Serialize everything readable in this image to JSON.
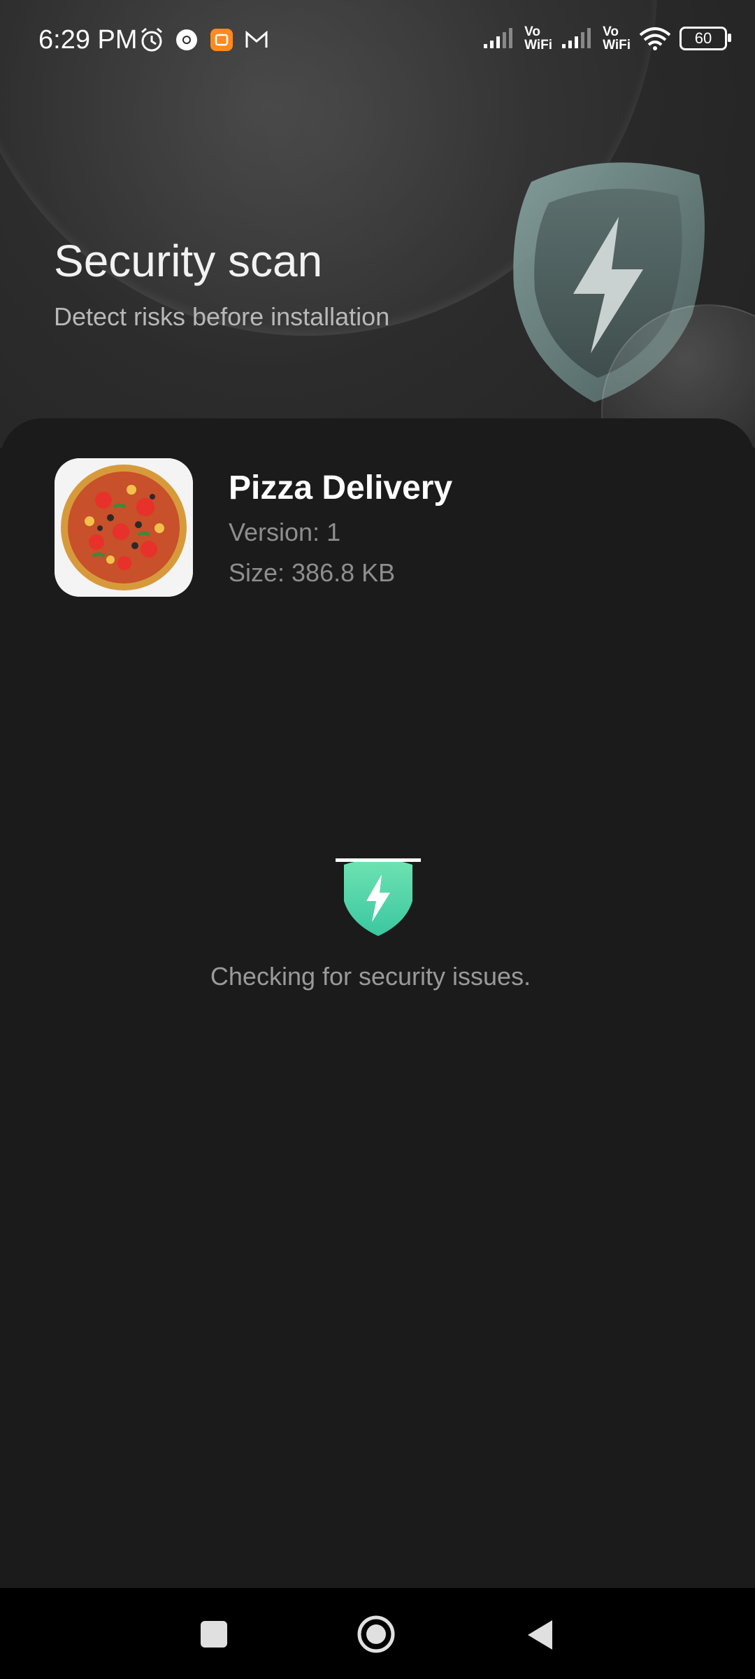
{
  "status_bar": {
    "time": "6:29 PM",
    "left_icons": [
      "alarm-icon",
      "chrome-icon",
      "mi-store-icon",
      "gmail-icon"
    ],
    "vo_wifi_1": "Vo\nWiFi",
    "vo_wifi_2": "Vo\nWiFi",
    "battery_level": "60"
  },
  "header": {
    "title": "Security scan",
    "subtitle": "Detect risks before installation"
  },
  "app": {
    "name": "Pizza Delivery",
    "version": "Version: 1",
    "size": "Size: 386.8 KB",
    "icon": "pizza-app-icon"
  },
  "scan": {
    "status_text": "Checking for security issues.",
    "icon": "shield-lightning-icon",
    "accent_color": "#4fd1a6"
  },
  "nav": {
    "icons": [
      "recent-apps-icon",
      "home-icon",
      "back-icon"
    ]
  }
}
